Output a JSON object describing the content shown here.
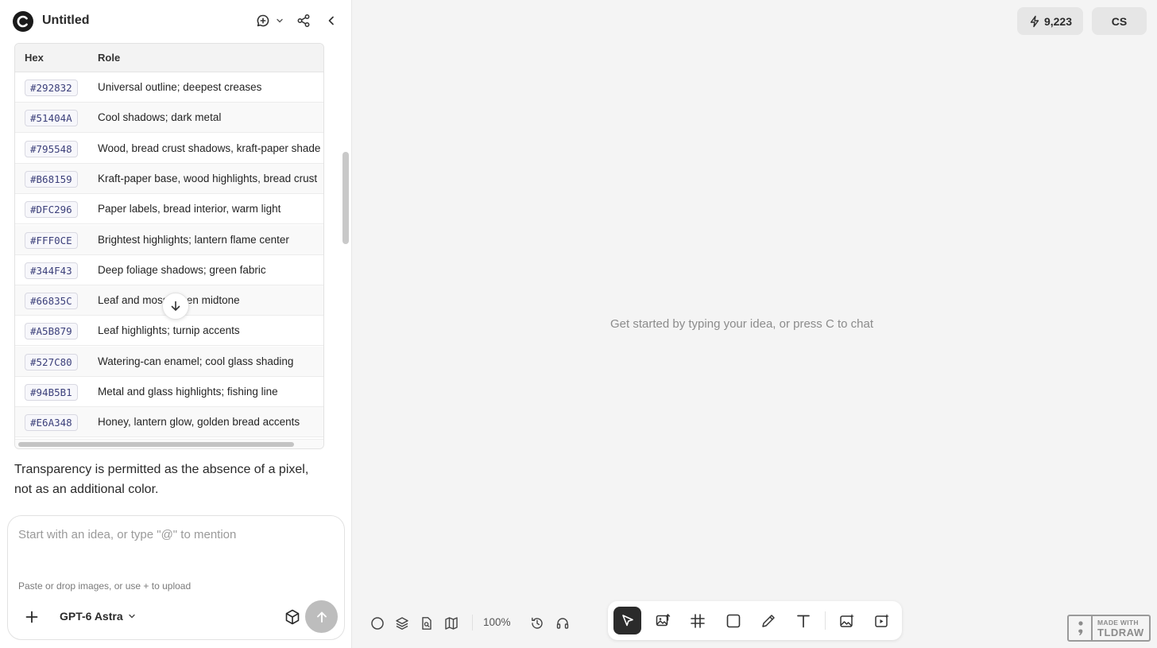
{
  "header": {
    "title": "Untitled"
  },
  "table": {
    "headers": [
      "Hex",
      "Role"
    ],
    "rows": [
      {
        "hex": "#292832",
        "role": "Universal outline; deepest creases"
      },
      {
        "hex": "#51404A",
        "role": "Cool shadows; dark metal"
      },
      {
        "hex": "#795548",
        "role": "Wood, bread crust shadows, kraft-paper shade"
      },
      {
        "hex": "#B68159",
        "role": "Kraft-paper base, wood highlights, bread crust"
      },
      {
        "hex": "#DFC296",
        "role": "Paper labels, bread interior, warm light"
      },
      {
        "hex": "#FFF0CE",
        "role": "Brightest highlights; lantern flame center"
      },
      {
        "hex": "#344F43",
        "role": "Deep foliage shadows; green fabric"
      },
      {
        "hex": "#66835C",
        "role": "Leaf and moss green midtone"
      },
      {
        "hex": "#A5B879",
        "role": "Leaf highlights; turnip accents"
      },
      {
        "hex": "#527C80",
        "role": "Watering-can enamel; cool glass shading"
      },
      {
        "hex": "#94B5B1",
        "role": "Metal and glass highlights; fishing line"
      },
      {
        "hex": "#E6A348",
        "role": "Honey, lantern glow, golden bread accents"
      }
    ]
  },
  "note": "Transparency is permitted as the absence of a pixel, not as an additional color.",
  "composer": {
    "placeholder": "Start with an idea, or type \"@\" to mention",
    "hint": "Paste or drop images, or use + to upload",
    "model": "GPT-6 Astra"
  },
  "canvas": {
    "hint": "Get started by typing your idea, or press C to chat",
    "credits": "9,223",
    "avatar": "CS",
    "zoom": "100%"
  },
  "badge": {
    "line1": "MADE WITH",
    "line2": "TLDRAW"
  },
  "icons": {
    "header": [
      "new-chat-icon",
      "chevron-down-icon",
      "share-icon",
      "collapse-panel-icon"
    ],
    "bottom_left": [
      "circle-icon",
      "layers-icon",
      "file-search-icon",
      "map-icon",
      "history-icon",
      "headset-icon"
    ],
    "toolbar": [
      "select-arrow-icon",
      "image-upload-icon",
      "frame-icon",
      "rectangle-icon",
      "pencil-icon",
      "text-icon",
      "ai-image-icon",
      "ai-video-icon"
    ]
  },
  "colors": {
    "accent_dark": "#2b2b2b",
    "background": "#f4f4f4"
  }
}
